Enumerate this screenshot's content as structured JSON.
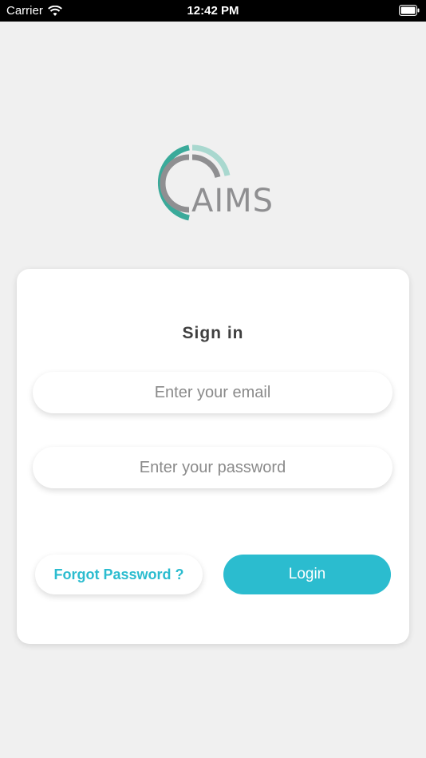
{
  "status_bar": {
    "carrier": "Carrier",
    "time": "12:42 PM"
  },
  "logo": {
    "text": "AIMS",
    "colors": {
      "teal": "#3aaa9a",
      "light_teal": "#a9d8cf",
      "gray": "#8f8f91"
    }
  },
  "sign_in": {
    "title": "Sign in",
    "email_placeholder": "Enter your email",
    "password_placeholder": "Enter your password",
    "forgot_label": "Forgot Password ?",
    "login_label": "Login"
  },
  "colors": {
    "accent": "#2bbccf",
    "background": "#f0f0f0",
    "card": "#ffffff"
  }
}
